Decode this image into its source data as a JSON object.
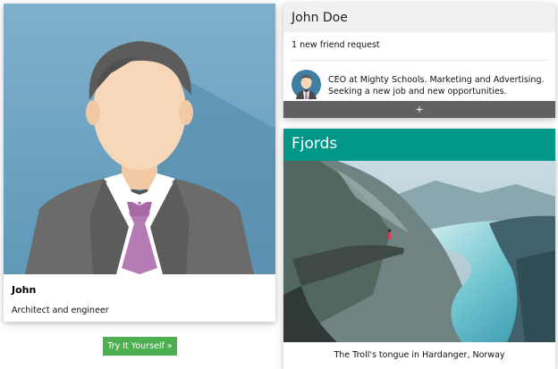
{
  "profile": {
    "name": "John",
    "role": "Architect and engineer",
    "try_button": "Try It Yourself »"
  },
  "social": {
    "title": "John Doe",
    "notification": "1 new friend request",
    "description": "CEO at Mighty Schools. Marketing and Advertising. Seeking a new job and new opportunities.",
    "add_label": "+"
  },
  "fjords": {
    "title": "Fjords",
    "caption": "The Troll's tongue in Hardanger, Norway"
  },
  "colors": {
    "accent_green": "#4caf50",
    "teal_header": "#009688",
    "dark_bar": "#616161",
    "light_header": "#f1f1f1"
  },
  "icons": {
    "avatar": "avatar-illustration",
    "landscape": "fjord-photo"
  }
}
